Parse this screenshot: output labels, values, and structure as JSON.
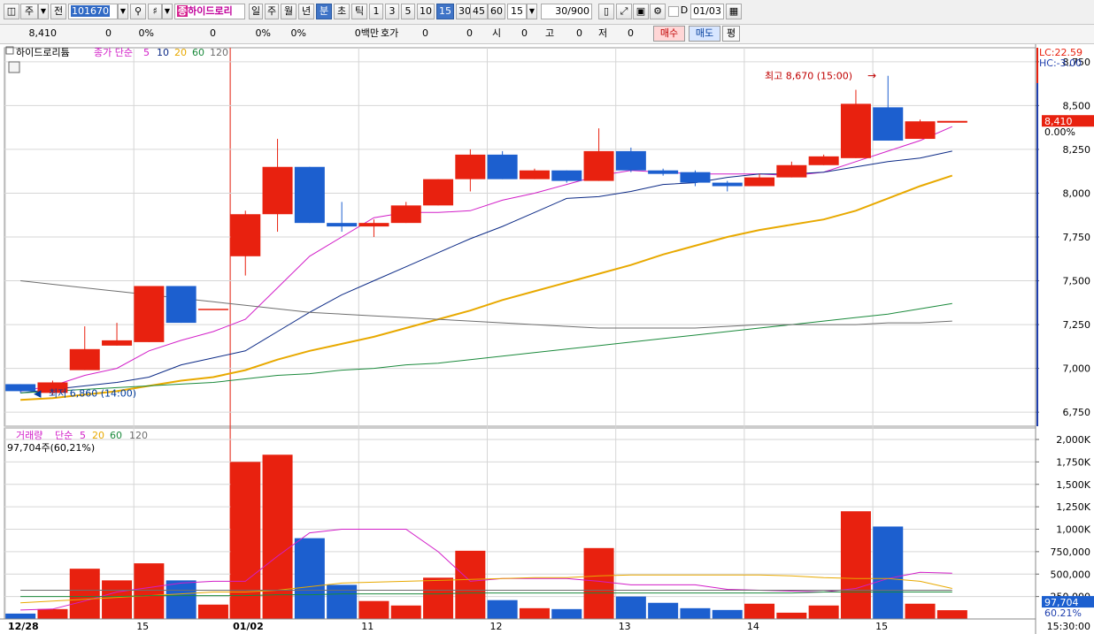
{
  "toolbar": {
    "market": "주",
    "prev_label": "전",
    "code": "101670",
    "name_prefix": "종",
    "name": "하이드로리",
    "periods": [
      "일",
      "주",
      "월",
      "년",
      "분",
      "초",
      "틱"
    ],
    "active_period": "분",
    "intervals": [
      "1",
      "3",
      "5",
      "10",
      "15",
      "30",
      "45",
      "60"
    ],
    "active_interval": "15",
    "interval_value": "15",
    "count": "30",
    "count_total": "/900",
    "checkbox_label": "D",
    "date": "01/03"
  },
  "quote": {
    "price": "8,410",
    "change": "0",
    "change_pct": "0%",
    "volume": "0",
    "pct2": "0%",
    "pct3": "0%",
    "unit_label": "0백만",
    "hoga_label": "호가",
    "hoga1": "0",
    "hoga2": "0",
    "open_label": "시",
    "open": "0",
    "high_label": "고",
    "high": "0",
    "low_label": "저",
    "low": "0",
    "buy": "매수",
    "sell": "매도",
    "avg": "평"
  },
  "price_legend": {
    "title": "하이드로리튬",
    "ma_prefix": "종가 단순",
    "periods": [
      "5",
      "10",
      "20",
      "60",
      "120"
    ]
  },
  "volume_legend": {
    "title": "거래량",
    "ma_prefix": "단순",
    "periods": [
      "5",
      "20",
      "60",
      "120"
    ],
    "value_text": "97,704주(60,21%)"
  },
  "annotations": {
    "high": "최고 8,670 (15:00)",
    "low": "최저 6,860 (14:00)"
  },
  "right_labels": {
    "lc": "LC:22.59",
    "hc": "HC:-3.00",
    "price": "8,410",
    "pct": "0.00%",
    "vol": "97,704",
    "vol_pct": "60.21%"
  },
  "colors": {
    "up": "#e8210f",
    "down": "#1c5fcf",
    "ma5": "#d21ec8",
    "ma10": "#0c2a86",
    "ma20": "#e8a900",
    "ma60": "#1b8a3c",
    "ma120": "#6e6e6e"
  },
  "chart_data": {
    "type": "candlestick",
    "interval_minutes": 15,
    "x_ticks": [
      "12/28",
      "15",
      "01/02",
      "11",
      "12",
      "13",
      "14",
      "15"
    ],
    "time_label": "15:30:00",
    "price_axis": [
      "8,750",
      "8,500",
      "8,250",
      "8,000",
      "7,750",
      "7,500",
      "7,250",
      "7,000",
      "6,750"
    ],
    "volume_axis": [
      "2,000K",
      "1,750K",
      "1,500K",
      "1,250K",
      "1,000K",
      "750,000",
      "500,000",
      "250,000"
    ],
    "ylim_price": [
      6670,
      8830
    ],
    "ylim_volume": [
      0,
      2000000
    ],
    "candles": [
      {
        "o": 6910,
        "h": 6910,
        "l": 6860,
        "c": 6870,
        "v": 60000
      },
      {
        "o": 6860,
        "h": 6930,
        "l": 6850,
        "c": 6920,
        "v": 110000
      },
      {
        "o": 6990,
        "h": 7240,
        "l": 6990,
        "c": 7110,
        "v": 560000
      },
      {
        "o": 7130,
        "h": 7260,
        "l": 7130,
        "c": 7160,
        "v": 430000
      },
      {
        "o": 7150,
        "h": 7470,
        "l": 7150,
        "c": 7470,
        "v": 620000
      },
      {
        "o": 7470,
        "h": 7470,
        "l": 7260,
        "c": 7260,
        "v": 430000
      },
      {
        "o": 7340,
        "h": 7340,
        "l": 7340,
        "c": 7340,
        "v": 160000
      },
      {
        "o": 7640,
        "h": 7900,
        "l": 7530,
        "c": 7880,
        "v": 1750000
      },
      {
        "o": 7880,
        "h": 8310,
        "l": 7780,
        "c": 8150,
        "v": 1830000
      },
      {
        "o": 8150,
        "h": 8150,
        "l": 7830,
        "c": 7830,
        "v": 900000
      },
      {
        "o": 7830,
        "h": 7950,
        "l": 7780,
        "c": 7810,
        "v": 380000
      },
      {
        "o": 7810,
        "h": 7850,
        "l": 7750,
        "c": 7830,
        "v": 200000
      },
      {
        "o": 7830,
        "h": 7950,
        "l": 7830,
        "c": 7930,
        "v": 150000
      },
      {
        "o": 7930,
        "h": 8080,
        "l": 7930,
        "c": 8080,
        "v": 460000
      },
      {
        "o": 8080,
        "h": 8250,
        "l": 8010,
        "c": 8220,
        "v": 760000
      },
      {
        "o": 8220,
        "h": 8240,
        "l": 8080,
        "c": 8080,
        "v": 210000
      },
      {
        "o": 8080,
        "h": 8140,
        "l": 8080,
        "c": 8130,
        "v": 120000
      },
      {
        "o": 8130,
        "h": 8130,
        "l": 8060,
        "c": 8070,
        "v": 110000
      },
      {
        "o": 8070,
        "h": 8370,
        "l": 8070,
        "c": 8240,
        "v": 790000
      },
      {
        "o": 8240,
        "h": 8260,
        "l": 8120,
        "c": 8130,
        "v": 250000
      },
      {
        "o": 8130,
        "h": 8140,
        "l": 8100,
        "c": 8110,
        "v": 180000
      },
      {
        "o": 8120,
        "h": 8130,
        "l": 8040,
        "c": 8060,
        "v": 120000
      },
      {
        "o": 8060,
        "h": 8070,
        "l": 8010,
        "c": 8040,
        "v": 100000
      },
      {
        "o": 8040,
        "h": 8110,
        "l": 8040,
        "c": 8090,
        "v": 170000
      },
      {
        "o": 8090,
        "h": 8180,
        "l": 8090,
        "c": 8160,
        "v": 70000
      },
      {
        "o": 8160,
        "h": 8220,
        "l": 8160,
        "c": 8210,
        "v": 150000
      },
      {
        "o": 8200,
        "h": 8590,
        "l": 8200,
        "c": 8510,
        "v": 1200000
      },
      {
        "o": 8490,
        "h": 8670,
        "l": 8300,
        "c": 8300,
        "v": 1030000
      },
      {
        "o": 8310,
        "h": 8420,
        "l": 8310,
        "c": 8410,
        "v": 170000
      },
      {
        "o": 8410,
        "h": 8410,
        "l": 8410,
        "c": 8410,
        "v": 97704
      }
    ],
    "price_mas": [
      {
        "name": "5",
        "values": [
          6870,
          6900,
          6960,
          7000,
          7100,
          7160,
          7210,
          7280,
          7460,
          7640,
          7750,
          7860,
          7890,
          7890,
          7900,
          7960,
          8000,
          8050,
          8100,
          8130,
          8120,
          8110,
          8110,
          8110,
          8100,
          8120,
          8180,
          8240,
          8300,
          8380
        ]
      },
      {
        "name": "10",
        "values": [
          6860,
          6880,
          6900,
          6920,
          6950,
          7020,
          7060,
          7100,
          7210,
          7320,
          7420,
          7500,
          7580,
          7660,
          7740,
          7810,
          7890,
          7970,
          7980,
          8010,
          8050,
          8060,
          8090,
          8110,
          8110,
          8120,
          8150,
          8180,
          8200,
          8240
        ]
      },
      {
        "name": "20",
        "values": [
          6820,
          6830,
          6850,
          6870,
          6900,
          6930,
          6950,
          6990,
          7050,
          7100,
          7140,
          7180,
          7230,
          7280,
          7330,
          7390,
          7440,
          7490,
          7540,
          7590,
          7650,
          7700,
          7750,
          7790,
          7820,
          7850,
          7900,
          7970,
          8040,
          8100
        ]
      },
      {
        "name": "60",
        "values": [
          6860,
          6870,
          6880,
          6890,
          6900,
          6910,
          6920,
          6940,
          6960,
          6970,
          6990,
          7000,
          7020,
          7030,
          7050,
          7070,
          7090,
          7110,
          7130,
          7150,
          7170,
          7190,
          7210,
          7230,
          7250,
          7270,
          7290,
          7310,
          7340,
          7370
        ]
      },
      {
        "name": "120",
        "values": [
          7500,
          7480,
          7460,
          7440,
          7420,
          7400,
          7380,
          7360,
          7340,
          7320,
          7310,
          7300,
          7290,
          7280,
          7270,
          7260,
          7250,
          7240,
          7230,
          7230,
          7230,
          7230,
          7240,
          7250,
          7250,
          7250,
          7250,
          7260,
          7260,
          7270
        ]
      }
    ],
    "volume_mas": [
      {
        "name": "5",
        "values": [
          100000,
          110000,
          200000,
          300000,
          350000,
          400000,
          420000,
          420000,
          700000,
          960000,
          1000000,
          1000000,
          1000000,
          750000,
          420000,
          450000,
          450000,
          450000,
          420000,
          380000,
          380000,
          380000,
          330000,
          320000,
          310000,
          300000,
          340000,
          450000,
          520000,
          510000
        ]
      },
      {
        "name": "20",
        "values": [
          180000,
          200000,
          220000,
          240000,
          260000,
          280000,
          300000,
          300000,
          320000,
          360000,
          400000,
          410000,
          420000,
          430000,
          440000,
          450000,
          460000,
          460000,
          480000,
          490000,
          490000,
          490000,
          490000,
          490000,
          480000,
          460000,
          450000,
          450000,
          420000,
          340000
        ]
      },
      {
        "name": "60",
        "values": [
          250000,
          250000,
          250000,
          250000,
          260000,
          260000,
          260000,
          260000,
          270000,
          270000,
          280000,
          280000,
          280000,
          280000,
          290000,
          290000,
          290000,
          290000,
          290000,
          290000,
          290000,
          290000,
          290000,
          290000,
          290000,
          300000,
          300000,
          300000,
          300000,
          300000
        ]
      },
      {
        "name": "120",
        "values": [
          320000,
          320000,
          320000,
          320000,
          320000,
          320000,
          320000,
          320000,
          320000,
          320000,
          320000,
          320000,
          320000,
          320000,
          320000,
          320000,
          320000,
          320000,
          320000,
          320000,
          320000,
          320000,
          320000,
          320000,
          320000,
          320000,
          320000,
          320000,
          320000,
          320000
        ]
      }
    ]
  }
}
